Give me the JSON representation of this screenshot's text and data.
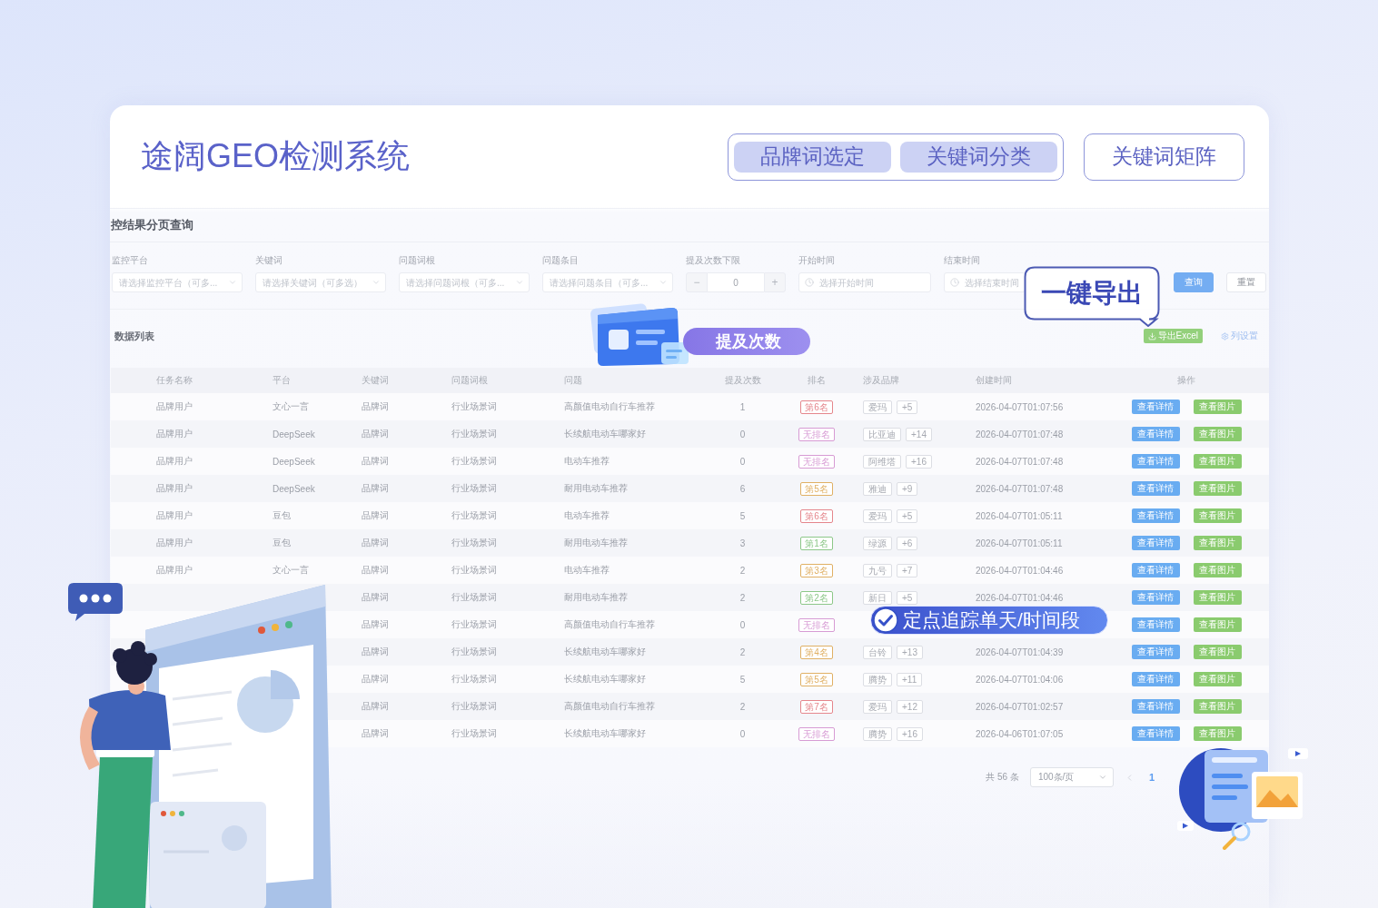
{
  "header": {
    "title": "途阔GEO检测系统",
    "tabs": [
      {
        "label": "品牌词选定",
        "selected": true
      },
      {
        "label": "关键词分类",
        "selected": true
      }
    ],
    "matrix_button": "关键词矩阵"
  },
  "query": {
    "title": "控结果分页查询",
    "filters": [
      {
        "kind": "select",
        "label": "监控平台",
        "placeholder": "请选择监控平台（可多..."
      },
      {
        "kind": "select",
        "label": "关键词",
        "placeholder": "请选择关键词（可多选）"
      },
      {
        "kind": "select",
        "label": "问题词根",
        "placeholder": "请选择问题词根（可多..."
      },
      {
        "kind": "select",
        "label": "问题条目",
        "placeholder": "请选择问题条目（可多..."
      },
      {
        "kind": "stepper",
        "label": "提及次数下限",
        "minus": "−",
        "value": "0",
        "plus": "+"
      },
      {
        "kind": "date",
        "label": "开始时间",
        "placeholder": "选择开始时间"
      },
      {
        "kind": "date",
        "label": "结束时间",
        "placeholder": "选择结束时间"
      }
    ],
    "buttons": [
      {
        "label": "查询",
        "kind": "primary"
      },
      {
        "label": "重置",
        "kind": "default"
      }
    ]
  },
  "data_list": {
    "title": "数据列表",
    "export_button": "导出Excel",
    "column_settings": "列设置",
    "columns": [
      "任务名称",
      "平台",
      "关键词",
      "问题词根",
      "问题",
      "提及次数",
      "排名",
      "涉及品牌",
      "创建时间",
      "操作"
    ],
    "rows": [
      {
        "task_name": "品牌用户",
        "platform": "文心一言",
        "keyword": "品牌词",
        "question_root": "行业场景词",
        "question": "高颜值电动自行车推荐",
        "mentions": "1",
        "rank": {
          "label": "第6名",
          "color": "#e5868c"
        },
        "brands": {
          "name": "爱玛",
          "more": "+5"
        },
        "created_at": "2026-04-07T01:07:56",
        "actions": [
          {
            "label": "查看详情",
            "kind": "primary"
          },
          {
            "label": "查看图片",
            "kind": "success"
          }
        ]
      },
      {
        "task_name": "品牌用户",
        "platform": "DeepSeek",
        "keyword": "品牌词",
        "question_root": "行业场景词",
        "question": "长续航电动车哪家好",
        "mentions": "0",
        "rank": {
          "label": "无排名",
          "color": "#d79bd4"
        },
        "brands": {
          "name": "比亚迪",
          "more": "+14"
        },
        "created_at": "2026-04-07T01:07:48",
        "actions": [
          {
            "label": "查看详情",
            "kind": "primary"
          },
          {
            "label": "查看图片",
            "kind": "success"
          }
        ]
      },
      {
        "task_name": "品牌用户",
        "platform": "DeepSeek",
        "keyword": "品牌词",
        "question_root": "行业场景词",
        "question": "电动车推荐",
        "mentions": "0",
        "rank": {
          "label": "无排名",
          "color": "#d79bd4"
        },
        "brands": {
          "name": "阿维塔",
          "more": "+16"
        },
        "created_at": "2026-04-07T01:07:48",
        "actions": [
          {
            "label": "查看详情",
            "kind": "primary"
          },
          {
            "label": "查看图片",
            "kind": "success"
          }
        ]
      },
      {
        "task_name": "品牌用户",
        "platform": "DeepSeek",
        "keyword": "品牌词",
        "question_root": "行业场景词",
        "question": "耐用电动车推荐",
        "mentions": "6",
        "rank": {
          "label": "第5名",
          "color": "#e0b064"
        },
        "brands": {
          "name": "雅迪",
          "more": "+9"
        },
        "created_at": "2026-04-07T01:07:48",
        "actions": [
          {
            "label": "查看详情",
            "kind": "primary"
          },
          {
            "label": "查看图片",
            "kind": "success"
          }
        ]
      },
      {
        "task_name": "品牌用户",
        "platform": "豆包",
        "keyword": "品牌词",
        "question_root": "行业场景词",
        "question": "电动车推荐",
        "mentions": "5",
        "rank": {
          "label": "第6名",
          "color": "#e5868c"
        },
        "brands": {
          "name": "爱玛",
          "more": "+5"
        },
        "created_at": "2026-04-07T01:05:11",
        "actions": [
          {
            "label": "查看详情",
            "kind": "primary"
          },
          {
            "label": "查看图片",
            "kind": "success"
          }
        ]
      },
      {
        "task_name": "品牌用户",
        "platform": "豆包",
        "keyword": "品牌词",
        "question_root": "行业场景词",
        "question": "耐用电动车推荐",
        "mentions": "3",
        "rank": {
          "label": "第1名",
          "color": "#8cc788"
        },
        "brands": {
          "name": "绿源",
          "more": "+6"
        },
        "created_at": "2026-04-07T01:05:11",
        "actions": [
          {
            "label": "查看详情",
            "kind": "primary"
          },
          {
            "label": "查看图片",
            "kind": "success"
          }
        ]
      },
      {
        "task_name": "品牌用户",
        "platform": "文心一言",
        "keyword": "品牌词",
        "question_root": "行业场景词",
        "question": "电动车推荐",
        "mentions": "2",
        "rank": {
          "label": "第3名",
          "color": "#e0b064"
        },
        "brands": {
          "name": "九号",
          "more": "+7"
        },
        "created_at": "2026-04-07T01:04:46",
        "actions": [
          {
            "label": "查看详情",
            "kind": "primary"
          },
          {
            "label": "查看图片",
            "kind": "success"
          }
        ]
      },
      {
        "keyword": "品牌词",
        "question_root": "行业场景词",
        "question": "耐用电动车推荐",
        "mentions": "2",
        "rank": {
          "label": "第2名",
          "color": "#8cc788"
        },
        "brands": {
          "name": "新日",
          "more": "+5"
        },
        "created_at": "2026-04-07T01:04:46",
        "actions": [
          {
            "label": "查看详情",
            "kind": "primary"
          },
          {
            "label": "查看图片",
            "kind": "success"
          }
        ]
      },
      {
        "keyword": "品牌词",
        "question_root": "行业场景词",
        "question": "高颜值电动自行车推荐",
        "mentions": "0",
        "rank": {
          "label": "无排名",
          "color": "#d79bd4"
        },
        "actions": [
          {
            "label": "查看详情",
            "kind": "primary"
          },
          {
            "label": "查看图片",
            "kind": "success"
          }
        ]
      },
      {
        "keyword": "品牌词",
        "question_root": "行业场景词",
        "question": "长续航电动车哪家好",
        "mentions": "2",
        "rank": {
          "label": "第4名",
          "color": "#e0b064"
        },
        "brands": {
          "name": "台铃",
          "more": "+13"
        },
        "created_at": "2026-04-07T01:04:39",
        "actions": [
          {
            "label": "查看详情",
            "kind": "primary"
          },
          {
            "label": "查看图片",
            "kind": "success"
          }
        ]
      },
      {
        "keyword": "品牌词",
        "question_root": "行业场景词",
        "question": "长续航电动车哪家好",
        "mentions": "5",
        "rank": {
          "label": "第5名",
          "color": "#e0b064"
        },
        "brands": {
          "name": "腾势",
          "more": "+11"
        },
        "created_at": "2026-04-07T01:04:06",
        "actions": [
          {
            "label": "查看详情",
            "kind": "primary"
          },
          {
            "label": "查看图片",
            "kind": "success"
          }
        ]
      },
      {
        "keyword": "品牌词",
        "question_root": "行业场景词",
        "question": "高颜值电动自行车推荐",
        "mentions": "2",
        "rank": {
          "label": "第7名",
          "color": "#e5868c"
        },
        "brands": {
          "name": "爱玛",
          "more": "+12"
        },
        "created_at": "2026-04-07T01:02:57",
        "actions": [
          {
            "label": "查看详情",
            "kind": "primary"
          },
          {
            "label": "查看图片",
            "kind": "success"
          }
        ]
      },
      {
        "keyword": "品牌词",
        "question_root": "行业场景词",
        "question": "长续航电动车哪家好",
        "mentions": "0",
        "rank": {
          "label": "无排名",
          "color": "#d79bd4"
        },
        "brands": {
          "name": "腾势",
          "more": "+16"
        },
        "created_at": "2026-04-06T01:07:05",
        "actions": [
          {
            "label": "查看详情",
            "kind": "primary"
          },
          {
            "label": "查看图片",
            "kind": "success"
          }
        ]
      }
    ],
    "pagination": {
      "total": "共 56 条",
      "page_size": "100条/页",
      "pages": [
        {
          "label": "1",
          "selected": true
        }
      ]
    }
  },
  "callouts": [
    {
      "kind": "pill",
      "text": "提及次数"
    },
    {
      "kind": "bubble",
      "text": "一键导出"
    },
    {
      "kind": "check",
      "text": "定点追踪单天/时间段"
    }
  ]
}
